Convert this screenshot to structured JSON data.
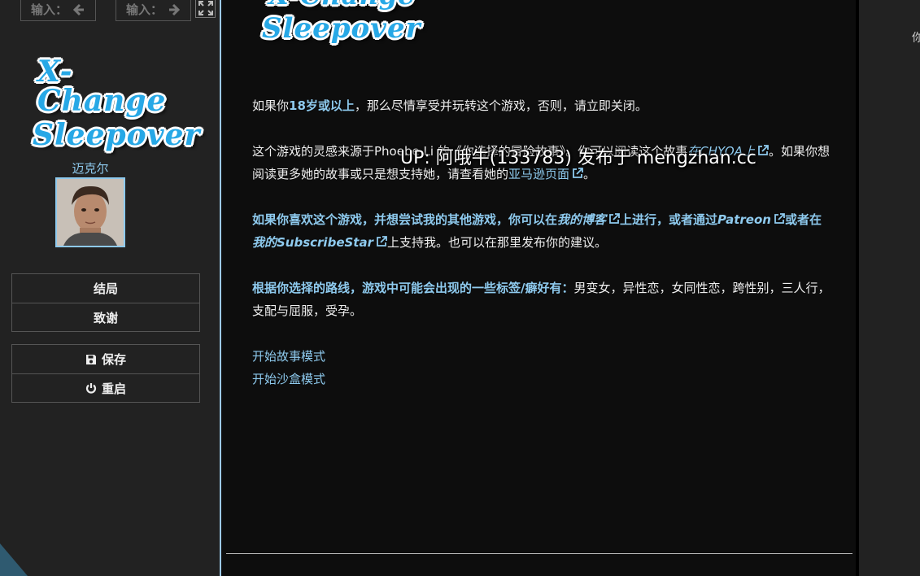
{
  "sidebar": {
    "history_back_label": "输入：",
    "history_forward_label": "输入：",
    "logo": {
      "line1": "X-Change",
      "line2": "Sleepover"
    },
    "character_name": "迈克尔",
    "menu_story": [
      {
        "label": "结局"
      },
      {
        "label": "致谢"
      }
    ],
    "menu_system": [
      {
        "label": "保存",
        "icon": "save-icon"
      },
      {
        "label": "重启",
        "icon": "power-icon"
      }
    ]
  },
  "header_logo": {
    "line1": "X-Change",
    "line2": "Sleepover"
  },
  "passage": {
    "p1": {
      "a": "如果你",
      "b": "18岁或以上",
      "c": "，那么尽情享受并玩转这个游戏，否则，请立即关闭。"
    },
    "p2": {
      "a": "这个游戏的灵感来源于Phoebe Li 的《你选择的冒险故事》。你可以阅读这个故事",
      "b": "在CHYOA上",
      "c": "。如果你想阅读更多她的故事或只是想支持她，请查看她的",
      "d": "亚马逊页面",
      "e": "。"
    },
    "p3": {
      "a": "如果你喜欢这个游戏，并想尝试我的其他游戏，你可以在",
      "b": "我的博客",
      "c": "上进行，或者通过",
      "d": "Patreon",
      "e": "或者在",
      "f": "我的SubscribeStar",
      "g": "上支持我。也可以在那里发布你的建议。"
    },
    "p4": {
      "a": "根据你选择的路线，游戏中可能会出现的一些标签/癖好有：",
      "b": "男变女，异性恋，女同性恋，跨性别，三人行，支配与屈服，受孕。"
    },
    "choices": [
      {
        "label": "开始故事模式"
      },
      {
        "label": "开始沙盒模式"
      }
    ]
  },
  "watermark": "UP: 阿哦牛(133783) 发布于 mengzhan.cc",
  "right_panel_text": "你",
  "colors": {
    "accent": "#8ecaee",
    "logo_blue": "#27a8e6",
    "background": "#111111",
    "sidebar": "#222222"
  }
}
